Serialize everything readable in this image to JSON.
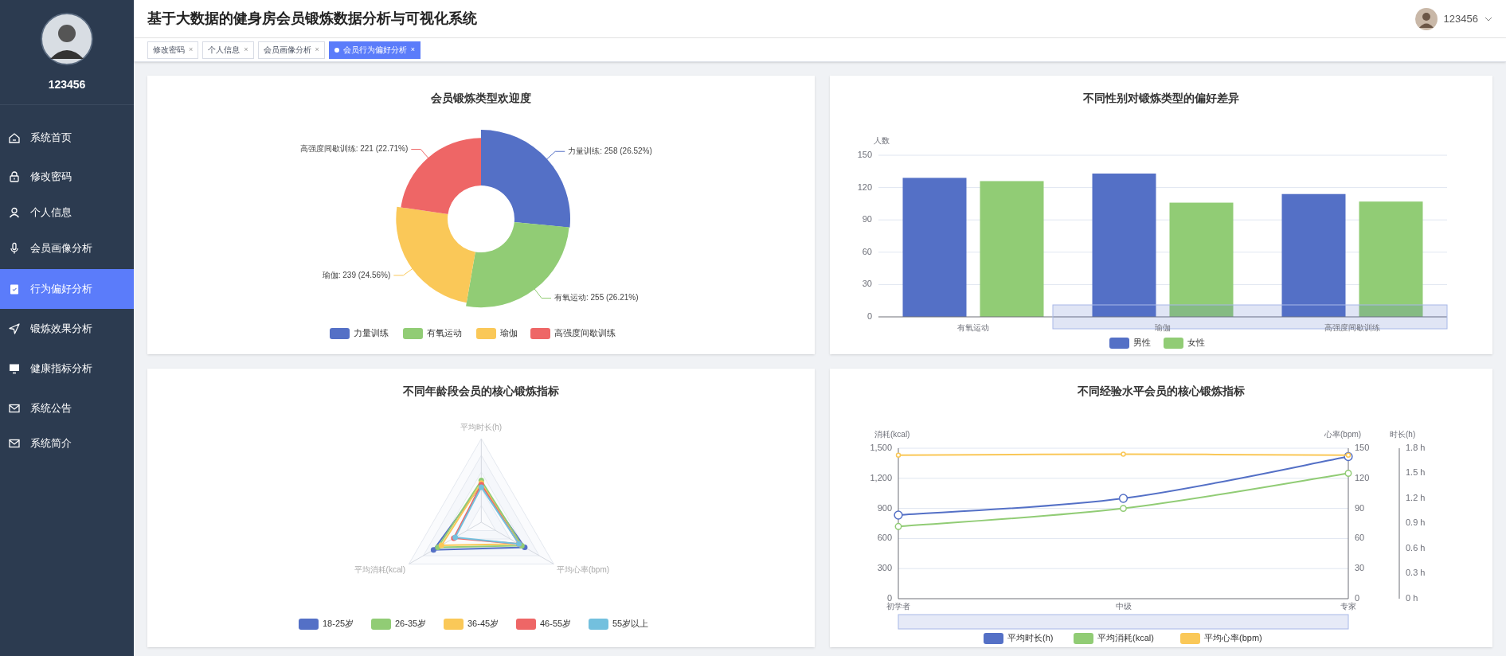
{
  "header": {
    "title": "基于大数据的健身房会员锻炼数据分析与可视化系统",
    "user": "123456"
  },
  "sidebar": {
    "username": "123456",
    "items": [
      {
        "label": "系统首页",
        "selected": false
      },
      {
        "label": "修改密码",
        "selected": false
      },
      {
        "label": "个人信息",
        "selected": false
      },
      {
        "label": "会员画像分析",
        "selected": false
      },
      {
        "label": "行为偏好分析",
        "selected": true
      },
      {
        "label": "锻炼效果分析",
        "selected": false
      },
      {
        "label": "健康指标分析",
        "selected": false
      },
      {
        "label": "系统公告",
        "selected": false
      },
      {
        "label": "系统简介",
        "selected": false
      }
    ]
  },
  "tabs": [
    {
      "label": "修改密码",
      "close": "×",
      "selected": false
    },
    {
      "label": "个人信息",
      "close": "×",
      "selected": false
    },
    {
      "label": "会员画像分析",
      "close": "×",
      "selected": false
    },
    {
      "label": "会员行为偏好分析",
      "close": "×",
      "selected": true
    }
  ],
  "panels": [
    {
      "chart_data": {
        "type": "donut",
        "title": "会员锻炼类型欢迎度",
        "categories": [
          "力量训练",
          "有氧运动",
          "瑜伽",
          "高强度间歇训练"
        ],
        "values": [
          258,
          255,
          239,
          221
        ],
        "colors": [
          "#5470c6",
          "#91cc75",
          "#fac858",
          "#ee6666"
        ],
        "legend": "bottom",
        "value_labels": [
          "力量训练: 258 (26.52%)",
          "有氧运动: 255 (26.21%)",
          "瑜伽: 239 (24.56%)",
          "高强度间歇训练: 221 (22.71%)"
        ]
      }
    },
    {
      "chart_data": {
        "type": "bar",
        "title": "不同性别对锻炼类型的偏好差异",
        "ylabel": "人数",
        "categories": [
          "有氧运动",
          "瑜伽",
          "高强度间歇训练"
        ],
        "ylim": [
          0,
          150
        ],
        "yticks": [
          0,
          30,
          60,
          90,
          120,
          150
        ],
        "grid": true,
        "legend": "bottom",
        "series": [
          {
            "name": "男性",
            "color": "#5470c6",
            "values": [
              129,
              133,
              114
            ]
          },
          {
            "name": "女性",
            "color": "#91cc75",
            "values": [
              126,
              106,
              107
            ]
          }
        ]
      }
    },
    {
      "kind": "radar",
      "title": "不同年龄段会员的核心锻炼指标",
      "axes": [
        "平均时长(h)",
        "平均消耗(kcal)",
        "平均心率(bpm)"
      ],
      "legend": [
        {
          "name": "18-25岁",
          "color": "#5470c6"
        },
        {
          "name": "26-35岁",
          "color": "#91cc75"
        },
        {
          "name": "36-45岁",
          "color": "#fac858"
        },
        {
          "name": "46-55岁",
          "color": "#ee6666"
        },
        {
          "name": "55岁以上",
          "color": "#73c0de"
        }
      ]
    },
    {
      "chart_data": {
        "type": "line",
        "title": "不同经验水平会员的核心锻炼指标",
        "categories": [
          "初学者",
          "中级",
          "专家"
        ],
        "ylabel": "消耗(kcal)",
        "ylim": [
          0,
          1500
        ],
        "grid": true,
        "legend": "bottom",
        "yticks": [
          {
            "value": 0,
            "label": "0"
          },
          {
            "value": 300,
            "label": "300"
          },
          {
            "value": 600,
            "label": "600"
          },
          {
            "value": 900,
            "label": "900"
          },
          {
            "value": 1200,
            "label": "1,200"
          },
          {
            "value": 1500,
            "label": "1,500"
          }
        ],
        "y2label": "心率(bpm)",
        "y2lim": [
          0,
          150
        ],
        "y2ticks": [
          0,
          30,
          60,
          90,
          120,
          150
        ],
        "y3label": "时长(h)",
        "y3lim": [
          0,
          1.8
        ],
        "y3ticks": [
          {
            "value": 0,
            "label": "0 h"
          },
          {
            "value": 0.3,
            "label": "0.3 h"
          },
          {
            "value": 0.6,
            "label": "0.6 h"
          },
          {
            "value": 0.9,
            "label": "0.9 h"
          },
          {
            "value": 1.2,
            "label": "1.2 h"
          },
          {
            "value": 1.5,
            "label": "1.5 h"
          },
          {
            "value": 1.8,
            "label": "1.8 h"
          }
        ],
        "series": [
          {
            "name": "平均时长(h)",
            "color": "#5470c6",
            "axis": "y3",
            "marker": "circle",
            "values": [
              1.0,
              1.2,
              1.7
            ]
          },
          {
            "name": "平均消耗(kcal)",
            "color": "#91cc75",
            "marker": "circle",
            "values": [
              720,
              900,
              1250
            ]
          },
          {
            "name": "平均心率(bpm)",
            "color": "#fac858",
            "axis": "y2",
            "marker": "circle",
            "values": [
              143,
              144,
              143
            ]
          }
        ]
      }
    }
  ]
}
